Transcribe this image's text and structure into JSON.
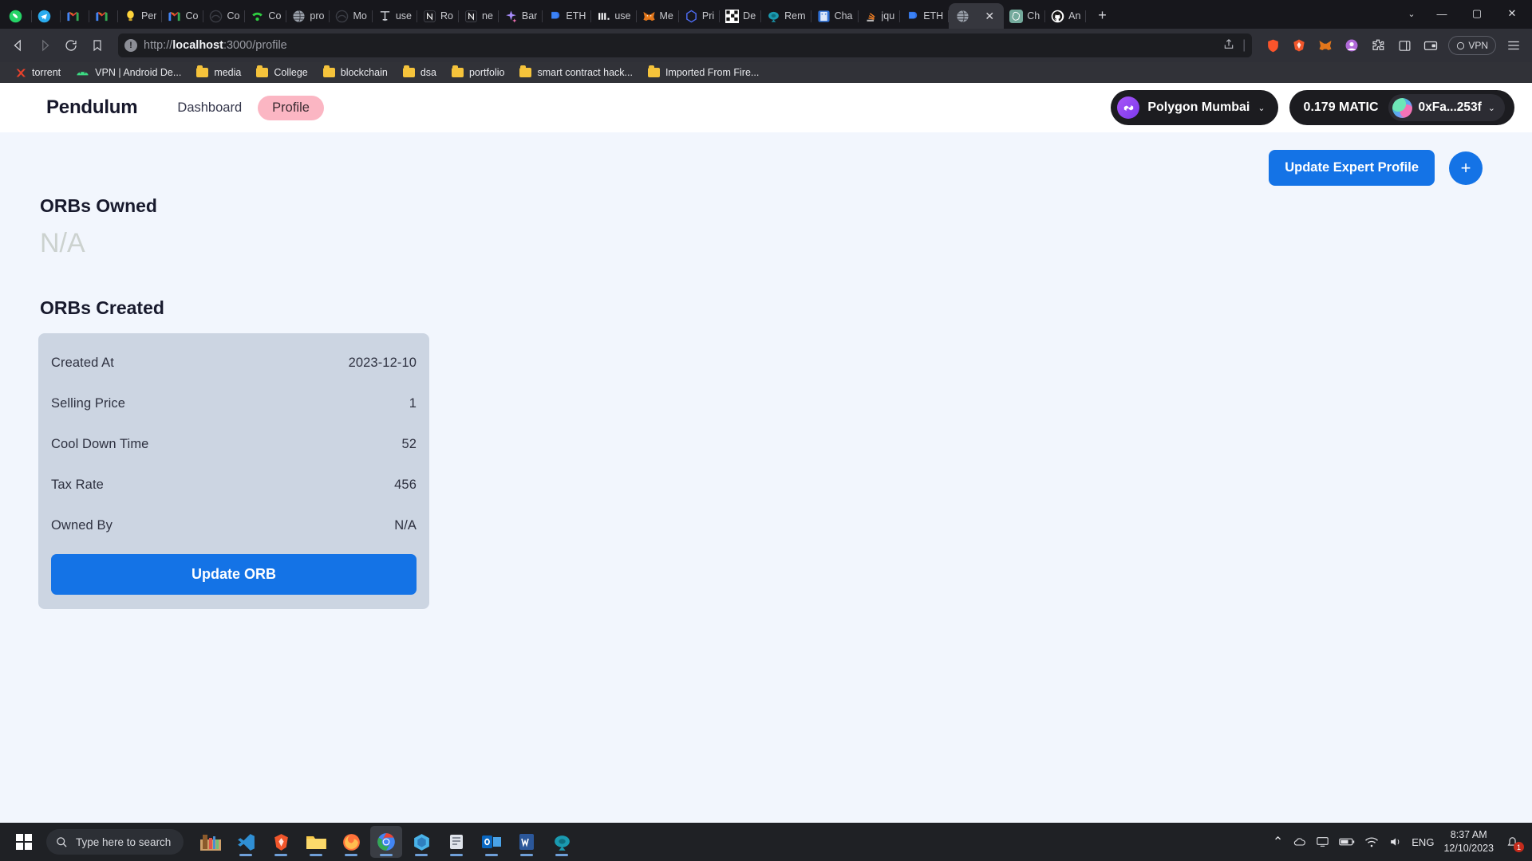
{
  "browser": {
    "tabs": [
      {
        "label": "",
        "icon": "whatsapp-icon"
      },
      {
        "label": "",
        "icon": "telegram-icon"
      },
      {
        "label": "",
        "icon": "gmail-icon"
      },
      {
        "label": "",
        "icon": "gmail-icon"
      },
      {
        "label": "Per",
        "icon": "lightbulb-icon"
      },
      {
        "label": "Co",
        "icon": "gmail-icon"
      },
      {
        "label": "Co",
        "icon": "mirror-icon"
      },
      {
        "label": "Co",
        "icon": "signal-icon"
      },
      {
        "label": "pro",
        "icon": "globe-icon"
      },
      {
        "label": "Mo",
        "icon": "mirror-icon"
      },
      {
        "label": "use",
        "icon": "tool-icon"
      },
      {
        "label": "Ro",
        "icon": "notion-icon"
      },
      {
        "label": "ne",
        "icon": "notion-icon"
      },
      {
        "label": "Bar",
        "icon": "sparkle-icon"
      },
      {
        "label": "ETH",
        "icon": "ethereum-icon"
      },
      {
        "label": "use",
        "icon": "bars-icon"
      },
      {
        "label": "Me",
        "icon": "metamask-fox-icon"
      },
      {
        "label": "Pri",
        "icon": "hexagon-icon"
      },
      {
        "label": "De",
        "icon": "checker-icon"
      },
      {
        "label": "Rem",
        "icon": "remix-icon"
      },
      {
        "label": "Cha",
        "icon": "chat-icon"
      },
      {
        "label": "jqu",
        "icon": "stackoverflow-icon"
      },
      {
        "label": "ETH",
        "icon": "ethereum-icon"
      },
      {
        "label": "",
        "icon": "globe-icon",
        "active": true
      },
      {
        "label": "Ch",
        "icon": "openai-icon"
      },
      {
        "label": "An",
        "icon": "github-icon"
      }
    ],
    "new_tab_label": "+",
    "tab_close_label": "✕",
    "tab_list_label": "⌄",
    "window_controls": {
      "minimize": "—",
      "maximize": "▢",
      "close": "✕"
    },
    "nav": {
      "back_label": "◁",
      "forward_label": "▷",
      "reload_label": "⟳",
      "bookmark_label": "bookmark",
      "url_scheme": "http://",
      "url_host": "localhost",
      "url_path": ":3000/profile",
      "url_full": "http://localhost:3000/profile",
      "vpn_label": "VPN"
    },
    "bookmarks": [
      {
        "label": "torrent",
        "icon": "utorrent-icon"
      },
      {
        "label": "VPN | Android De...",
        "icon": "android-icon"
      },
      {
        "label": "media",
        "icon": "folder-icon"
      },
      {
        "label": "College",
        "icon": "folder-icon"
      },
      {
        "label": "blockchain",
        "icon": "folder-icon"
      },
      {
        "label": "dsa",
        "icon": "folder-icon"
      },
      {
        "label": "portfolio",
        "icon": "folder-icon"
      },
      {
        "label": "smart contract hack...",
        "icon": "folder-icon"
      },
      {
        "label": "Imported From Fire...",
        "icon": "folder-icon"
      }
    ]
  },
  "app": {
    "brand": "Pendulum",
    "nav_links": [
      {
        "label": "Dashboard",
        "active": false
      },
      {
        "label": "Profile",
        "active": true
      }
    ],
    "network": {
      "name": "Polygon Mumbai",
      "chevron": "⌄",
      "logo": "polygon-logo"
    },
    "wallet": {
      "balance": "0.179 MATIC",
      "address": "0xFa...253f",
      "chevron": "⌄"
    },
    "actions": {
      "update_expert_profile": "Update Expert Profile",
      "add_label": "+"
    },
    "orbs_owned": {
      "title": "ORBs Owned",
      "value": "N/A"
    },
    "orbs_created": {
      "title": "ORBs Created",
      "rows": [
        {
          "label": "Created At",
          "value": "2023-12-10"
        },
        {
          "label": "Selling Price",
          "value": "1"
        },
        {
          "label": "Cool Down Time",
          "value": "52"
        },
        {
          "label": "Tax Rate",
          "value": "456"
        },
        {
          "label": "Owned By",
          "value": "N/A"
        }
      ],
      "update_button": "Update ORB"
    },
    "colors": {
      "accent_blue": "#1473e6",
      "profile_pill_pink": "#fbb6c3",
      "card_bg": "#ccd5e2",
      "page_bg": "#f2f6fd",
      "heading": "#181a2d"
    }
  },
  "taskbar": {
    "search_placeholder": "Type here to search",
    "apps": [
      {
        "name": "taskbar-app-store",
        "icon": "store-icon"
      },
      {
        "name": "taskbar-app-vscode",
        "icon": "vscode-icon"
      },
      {
        "name": "taskbar-app-brave",
        "icon": "brave-icon"
      },
      {
        "name": "taskbar-app-explorer",
        "icon": "folder-icon"
      },
      {
        "name": "taskbar-app-firefox",
        "icon": "firefox-icon"
      },
      {
        "name": "taskbar-app-chrome",
        "icon": "chrome-icon"
      },
      {
        "name": "taskbar-app-postman",
        "icon": "postman-icon"
      },
      {
        "name": "taskbar-app-notes",
        "icon": "notes-icon"
      },
      {
        "name": "taskbar-app-outlook",
        "icon": "outlook-icon"
      },
      {
        "name": "taskbar-app-word",
        "icon": "word-icon"
      },
      {
        "name": "taskbar-app-remix",
        "icon": "remix-icon"
      }
    ],
    "tray": {
      "overflow": "⌃",
      "language": "ENG",
      "time": "8:37 AM",
      "date": "12/10/2023",
      "notification_count": "1"
    }
  }
}
